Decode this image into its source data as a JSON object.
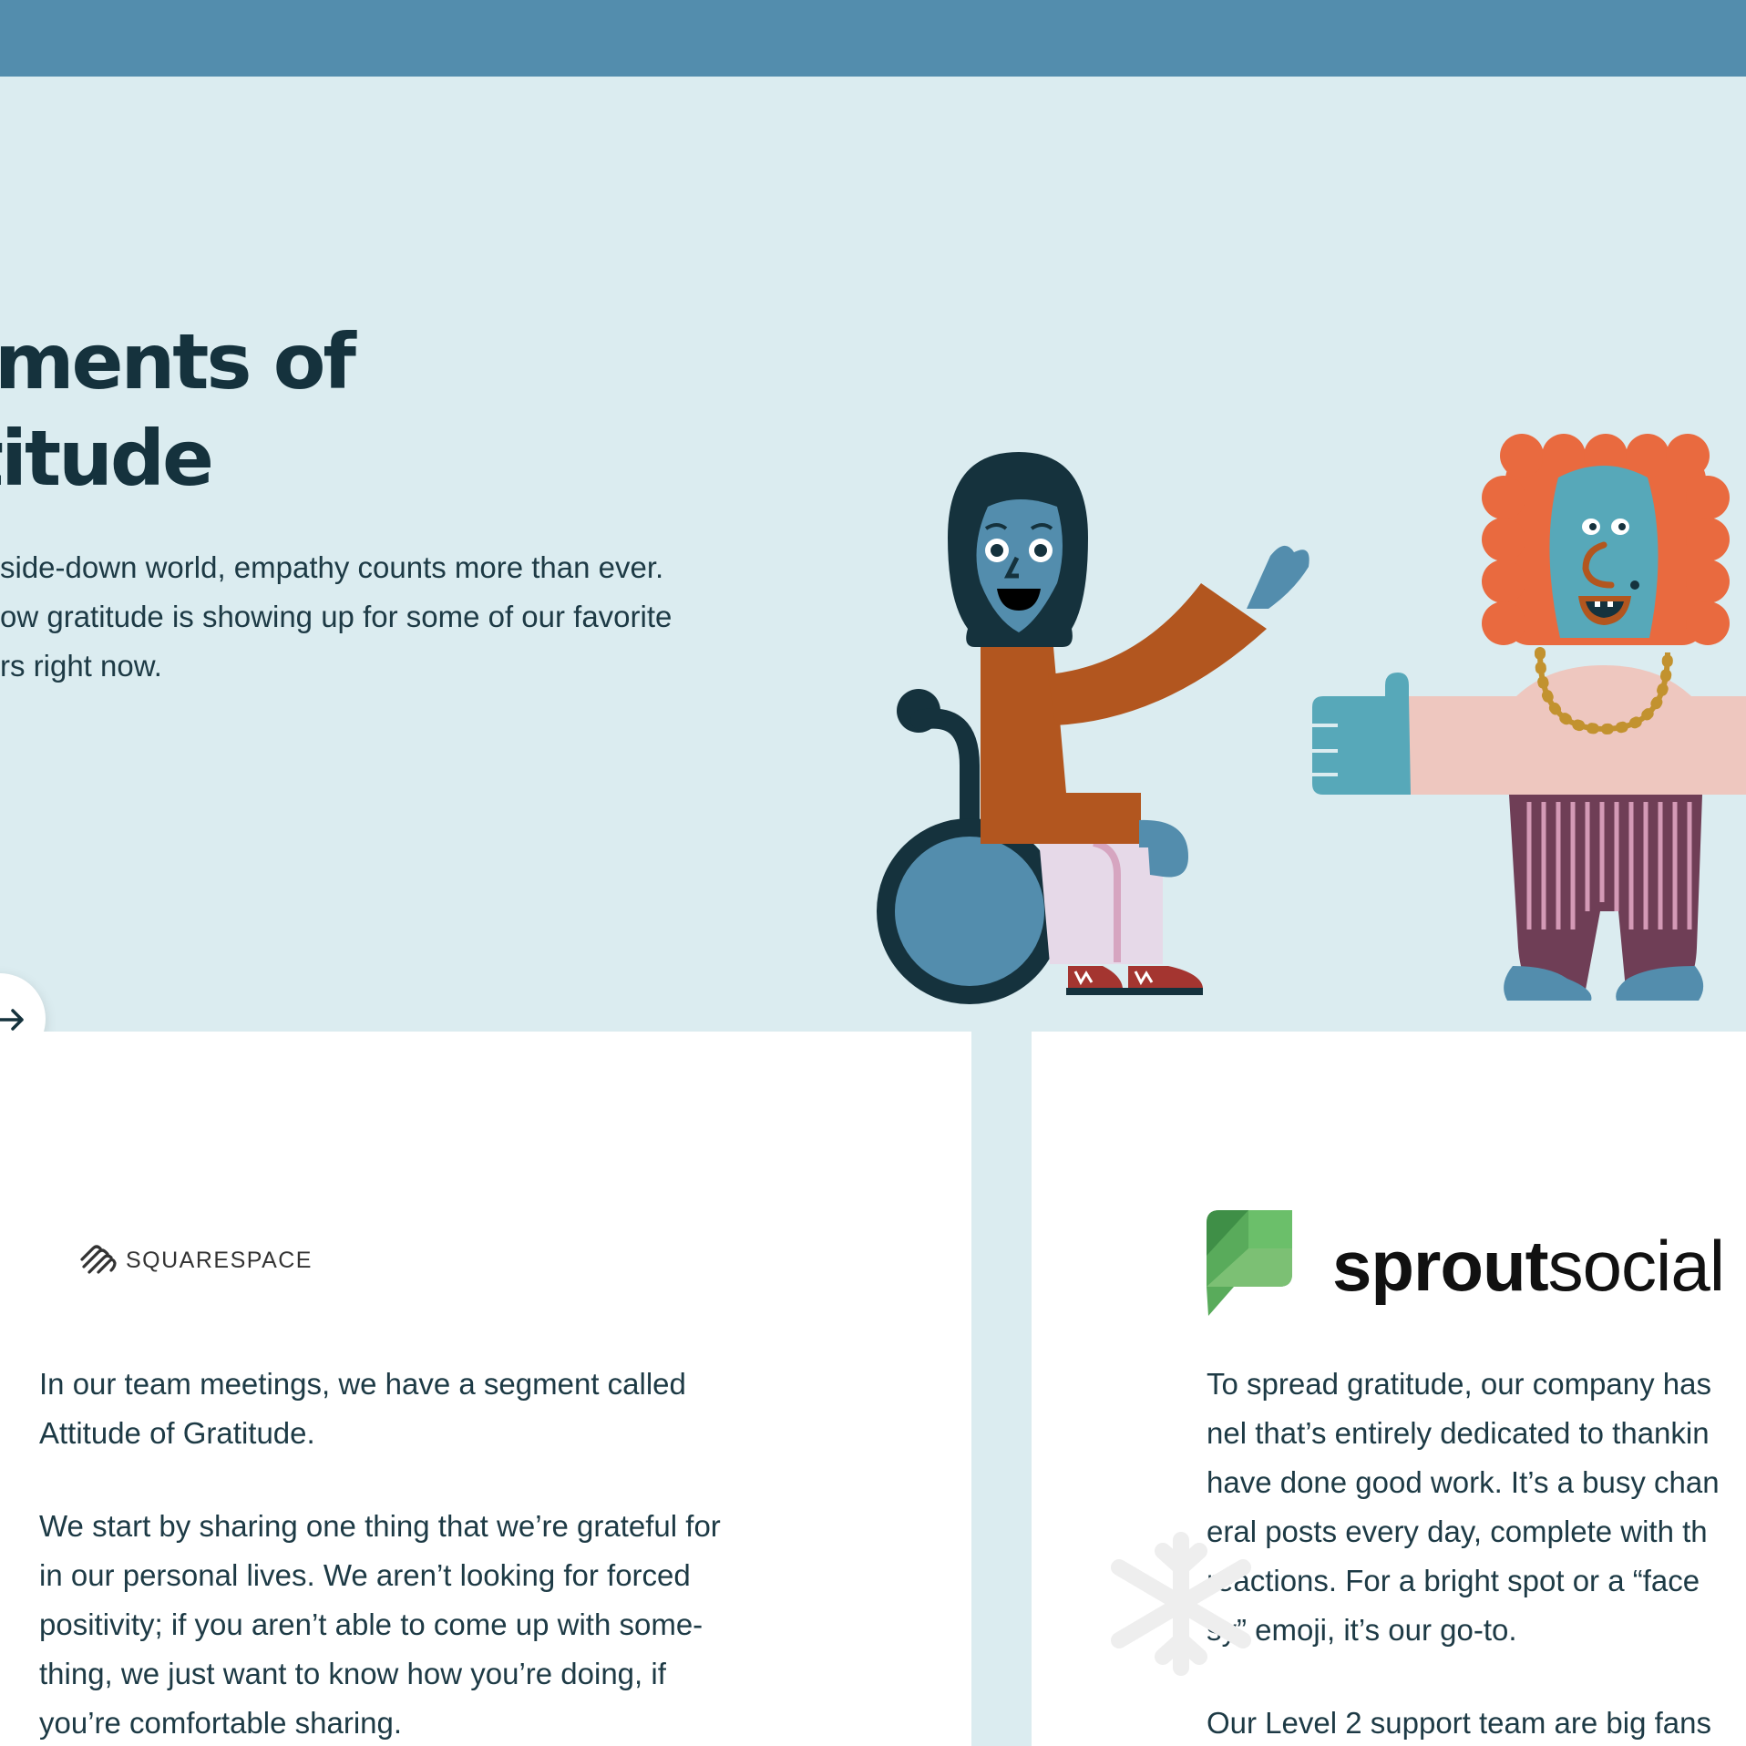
{
  "hero": {
    "title_line1": "ments of",
    "title_line2": "titude",
    "text_line1": "side-down world, empathy counts more than ever.",
    "text_line2": "ow gratitude is showing up for some of our favorite",
    "text_line3": "rs right now.",
    "next_icon": "arrow-right-icon"
  },
  "cards": {
    "left": {
      "logo_text": "SQUARESPACE",
      "p1": [
        "In our team meetings, we have a segment called",
        "Attitude of Gratitude."
      ],
      "p2": [
        "We start by sharing one thing that we’re grateful for",
        "in our personal lives. We aren’t looking for forced",
        "positivity; if you aren’t able to come up with some-",
        "thing, we just want to know how you’re doing, if",
        "you’re comfortable sharing."
      ]
    },
    "right": {
      "logo_bold": "sprout",
      "logo_light": "social",
      "p1": [
        "To spread gratitude, our company has",
        "nel that’s entirely dedicated to thankin",
        "have done good work. It’s a busy chan",
        "eral posts every day, complete with th",
        "reactions. For a bright spot or a “face",
        "sy” emoji, it’s our go-to."
      ],
      "p2": [
        "Our Level 2 support team are big fans"
      ]
    }
  },
  "colors": {
    "topbar": "#538dad",
    "hero_bg": "#dbecf0",
    "text_dark": "#15323d",
    "card_bg": "#ffffff"
  }
}
